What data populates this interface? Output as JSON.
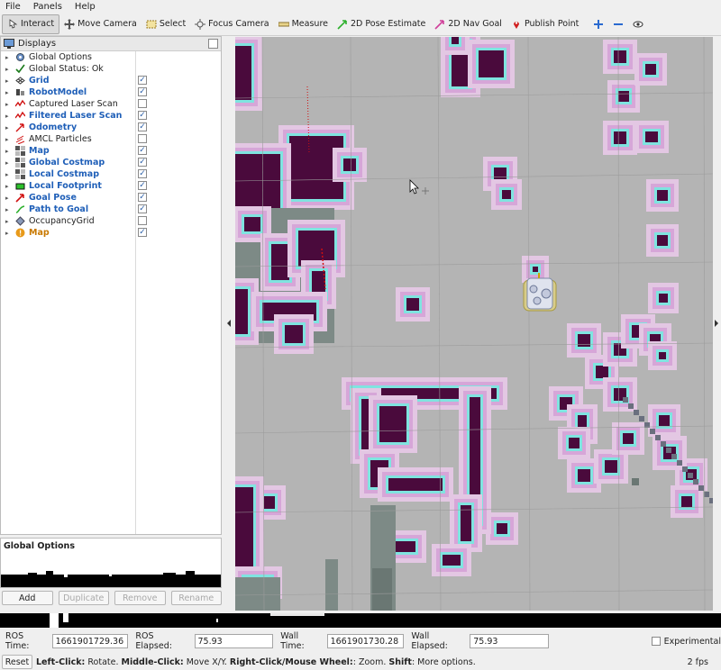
{
  "menu": {
    "file": "File",
    "panels": "Panels",
    "help": "Help"
  },
  "toolbar": {
    "interact": "Interact",
    "move_camera": "Move Camera",
    "select": "Select",
    "focus_camera": "Focus Camera",
    "measure": "Measure",
    "pose_estimate": "2D Pose Estimate",
    "nav_goal": "2D Nav Goal",
    "publish_point": "Publish Point"
  },
  "displays": {
    "title": "Displays",
    "items": [
      {
        "label": "Global Options",
        "style": "plain",
        "icon": "gear-icon",
        "checked": null
      },
      {
        "label": "Global Status: Ok",
        "style": "plain",
        "icon": "checkmark-icon",
        "checked": null
      },
      {
        "label": "Grid",
        "style": "on",
        "icon": "grid-icon",
        "checked": true
      },
      {
        "label": "RobotModel",
        "style": "on",
        "icon": "robot-icon",
        "checked": true
      },
      {
        "label": "Captured Laser Scan",
        "style": "plain",
        "icon": "laserscan-icon",
        "checked": false
      },
      {
        "label": "Filtered Laser Scan",
        "style": "on",
        "icon": "laserscan-icon",
        "checked": true
      },
      {
        "label": "Odometry",
        "style": "on",
        "icon": "odometry-icon",
        "checked": true
      },
      {
        "label": "AMCL Particles",
        "style": "plain",
        "icon": "particles-icon",
        "checked": false
      },
      {
        "label": "Map",
        "style": "on",
        "icon": "map-icon",
        "checked": true
      },
      {
        "label": "Global Costmap",
        "style": "on",
        "icon": "map-icon",
        "checked": true
      },
      {
        "label": "Local Costmap",
        "style": "on",
        "icon": "map-icon",
        "checked": true
      },
      {
        "label": "Local Footprint",
        "style": "on",
        "icon": "polygon-icon",
        "checked": true
      },
      {
        "label": "Goal Pose",
        "style": "on",
        "icon": "pose-icon",
        "checked": true
      },
      {
        "label": "Path to Goal",
        "style": "on",
        "icon": "path-icon",
        "checked": true
      },
      {
        "label": "OccupancyGrid",
        "style": "plain",
        "icon": "diamond-icon",
        "checked": false
      },
      {
        "label": "Map",
        "style": "warn",
        "icon": "warning-icon",
        "checked": true
      }
    ]
  },
  "properties": {
    "title": "Global Options"
  },
  "buttons": {
    "add": "Add",
    "duplicate": "Duplicate",
    "remove": "Remove",
    "rename": "Rename"
  },
  "time": {
    "ros_time_label": "ROS Time:",
    "ros_time": "1661901729.36",
    "ros_elapsed_label": "ROS Elapsed:",
    "ros_elapsed": "75.93",
    "wall_time_label": "Wall Time:",
    "wall_time": "1661901730.28",
    "wall_elapsed_label": "Wall Elapsed:",
    "wall_elapsed": "75.93",
    "experimental": "Experimental"
  },
  "status": {
    "reset": "Reset",
    "hint_b1": "Left-Click:",
    "hint_t1": " Rotate. ",
    "hint_b2": "Middle-Click:",
    "hint_t2": " Move X/Y. ",
    "hint_b3": "Right-Click/Mouse Wheel:",
    "hint_t3": ": Zoom. ",
    "hint_b4": "Shift",
    "hint_t4": ": More options.",
    "fps": "2 fps"
  },
  "colors": {
    "active_label": "#1f5fb8",
    "warn_label": "#c87800",
    "obstacle": "#4a0a3c",
    "inflation": "#d6a6d8",
    "inscribed": "#7fe4e0",
    "map_bg": "#b4b4b4"
  }
}
